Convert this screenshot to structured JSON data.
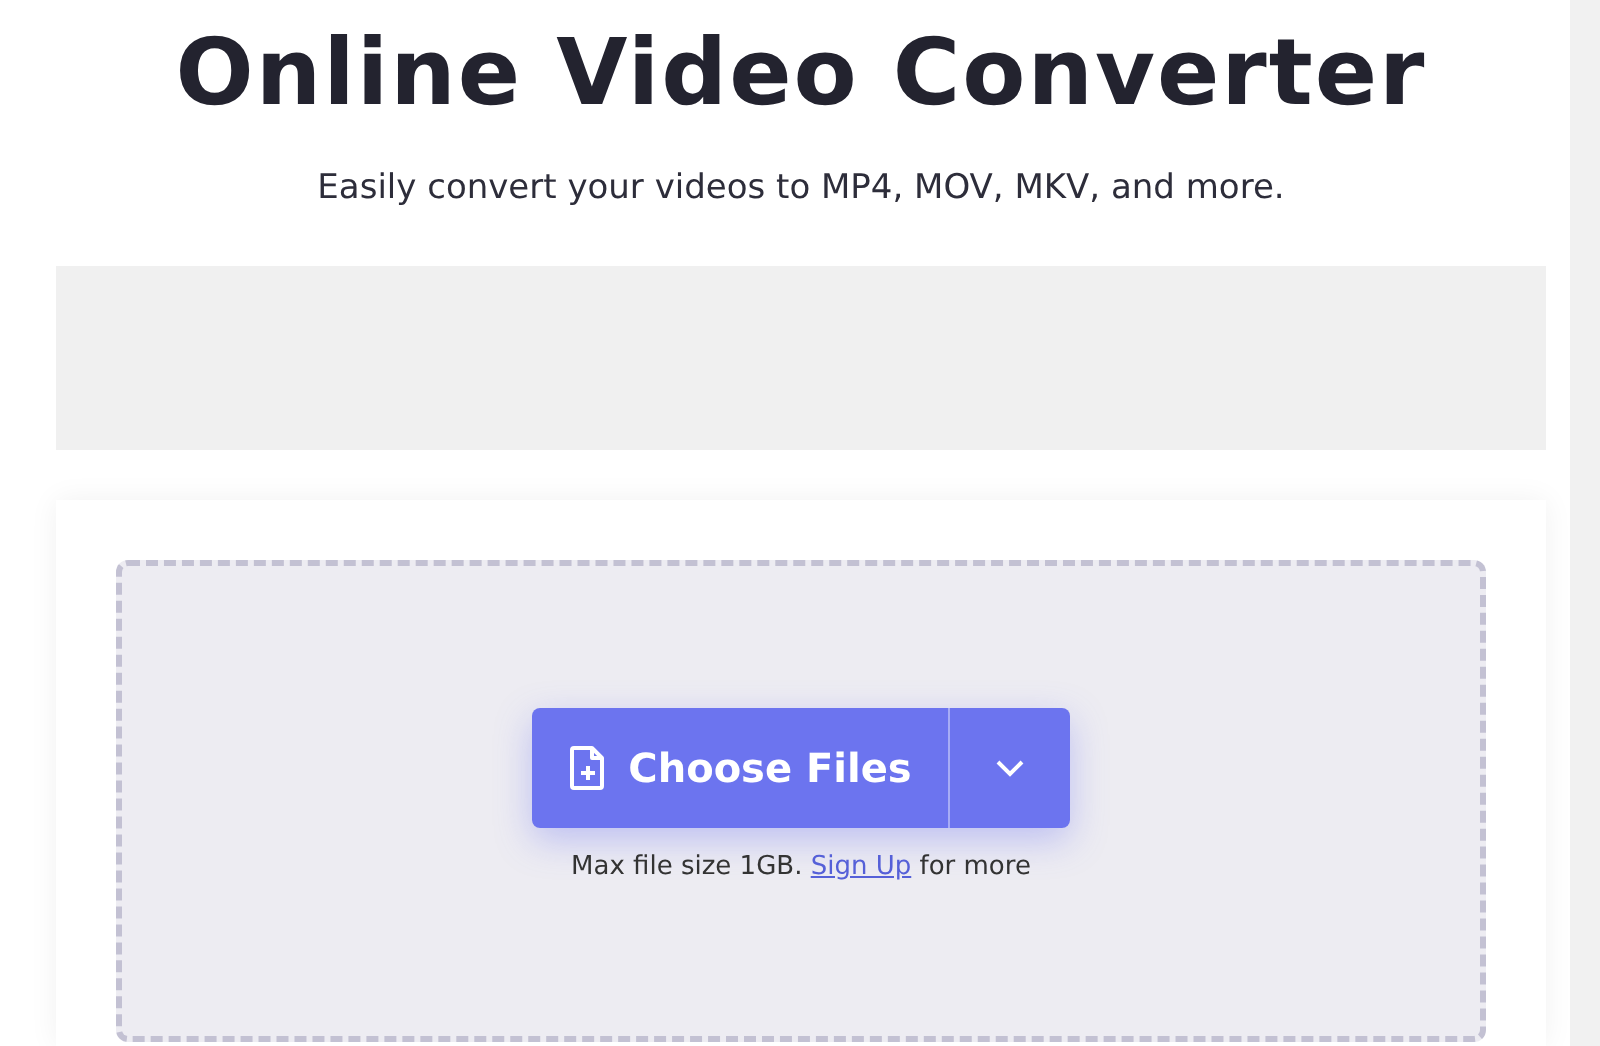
{
  "header": {
    "title": "Online Video Converter",
    "subtitle": "Easily convert your videos to MP4, MOV, MKV, and more."
  },
  "uploader": {
    "button_label": "Choose Files",
    "note_before": "Max file size 1GB.",
    "note_link": "Sign Up",
    "note_after": "for more"
  }
}
